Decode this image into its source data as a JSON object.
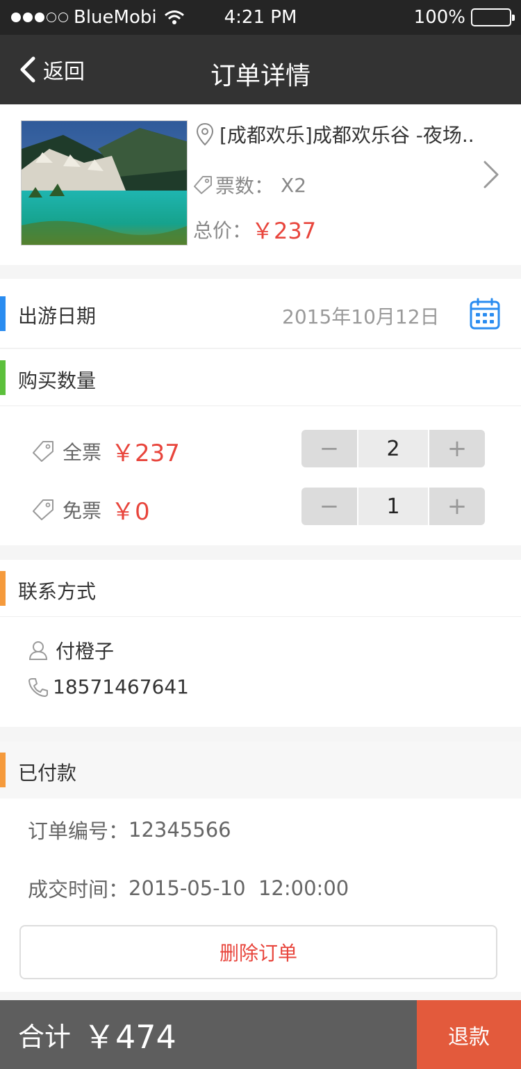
{
  "status_bar": {
    "carrier": "BlueMobi",
    "time": "4:21 PM",
    "battery": "100%"
  },
  "nav": {
    "back_label": "返回",
    "title": "订单详情"
  },
  "product": {
    "name": "[成都欢乐]成都欢乐谷 -夜场...",
    "tickets_label": "票数：",
    "tickets_value": "X2",
    "total_label": "总价：",
    "total_value": "￥237"
  },
  "trip_date": {
    "label": "出游日期",
    "value": "2015年10月12日"
  },
  "quantity": {
    "label": "购买数量",
    "items": [
      {
        "name": "全票",
        "price": "￥237",
        "count": "2"
      },
      {
        "name": "免票",
        "price": "￥0",
        "count": "1"
      }
    ]
  },
  "contact": {
    "label": "联系方式",
    "name": "付橙子",
    "phone": "18571467641"
  },
  "payment": {
    "label": "已付款",
    "order_no_label": "订单编号：",
    "order_no": "12345566",
    "deal_time_label": "成交时间：",
    "deal_time": "2015-05-10  12:00:00",
    "delete_label": "删除订单"
  },
  "footer": {
    "total_label": "合计",
    "total_value": "￥474",
    "refund_label": "退款"
  },
  "colors": {
    "accent_red": "#e8453c",
    "date_bar": "#2a8cf0",
    "quantity_bar": "#5cc03c",
    "contact_bar": "#f59a3c",
    "refund_bg": "#e35a3c"
  }
}
